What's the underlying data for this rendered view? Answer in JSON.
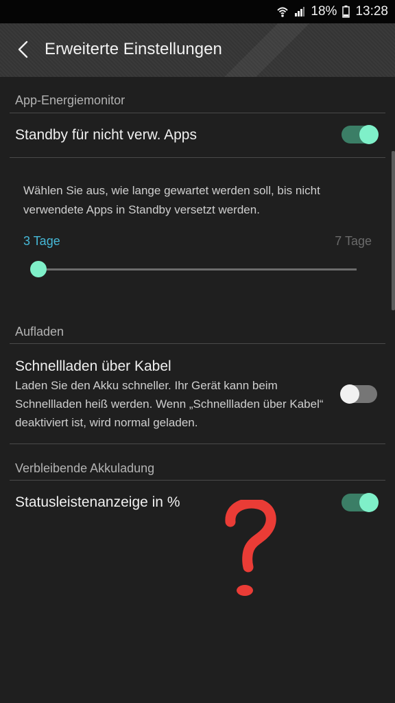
{
  "status_bar": {
    "battery_percent": "18%",
    "time": "13:28",
    "icons": [
      "wifi-icon",
      "signal-icon",
      "battery-icon"
    ]
  },
  "app_bar": {
    "title": "Erweiterte Einstellungen",
    "back_icon": "back-arrow-icon"
  },
  "sections": {
    "app_power": {
      "header": "App-Energiemonitor",
      "standby": {
        "label": "Standby für nicht verw. Apps",
        "enabled": true
      },
      "description": "Wählen Sie aus, wie lange gewartet werden soll, bis nicht verwendete Apps in Standby versetzt werden.",
      "slider": {
        "min_label": "3 Tage",
        "max_label": "7 Tage",
        "value": 0
      }
    },
    "charging": {
      "header": "Aufladen",
      "fast_cable": {
        "label": "Schnellladen über Kabel",
        "description": "Laden Sie den Akku schneller. Ihr Gerät kann beim Schnellladen heiß werden. Wenn „Schnellladen über Kabel“ deaktiviert ist, wird normal geladen.",
        "enabled": false
      }
    },
    "remaining_battery": {
      "header": "Verbleibende Akkuladung",
      "statusbar_percent": {
        "label": "Statusleistenanzeige in %",
        "enabled": true
      }
    }
  },
  "colors": {
    "accent": "#7ff0c9",
    "accent_dark": "#3b7e66",
    "slider_label": "#46b9d8",
    "annotation": "#ea3c36"
  }
}
